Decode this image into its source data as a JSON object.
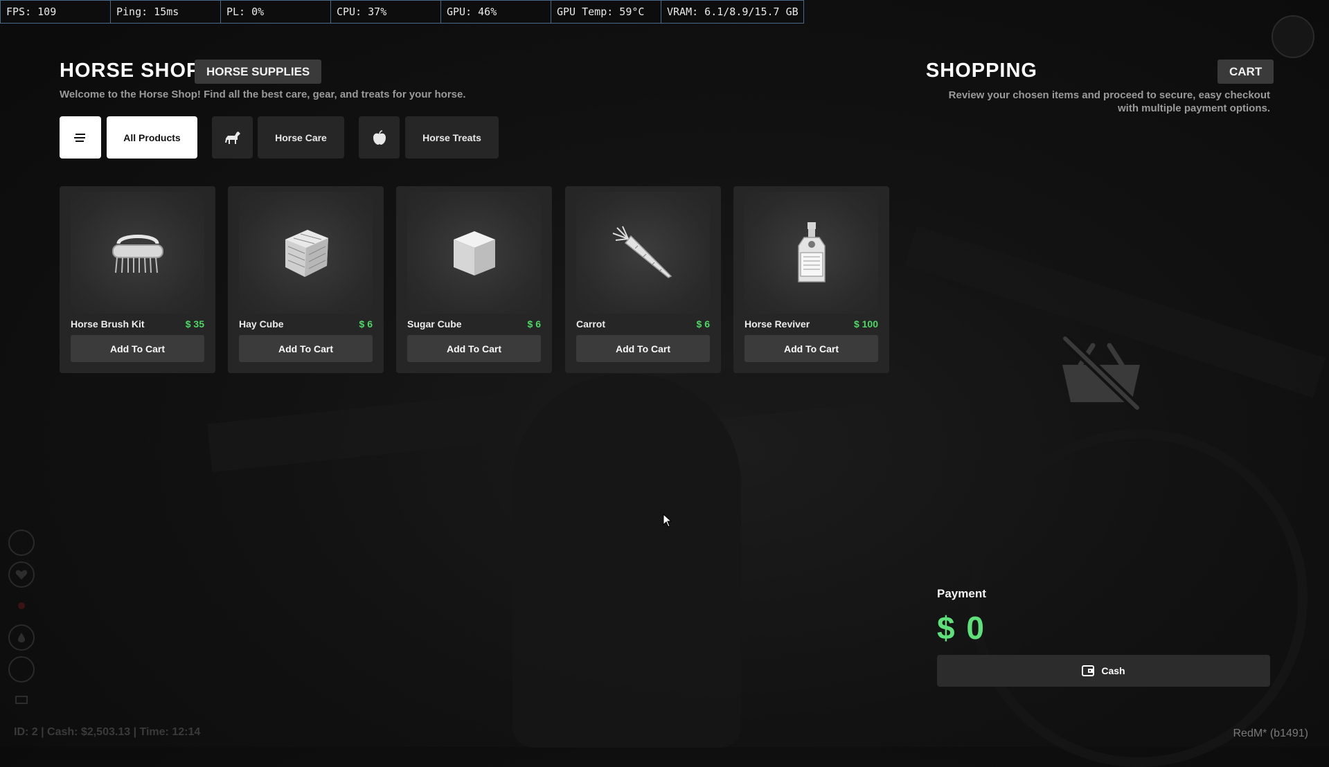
{
  "perf": [
    {
      "label": "FPS: 109"
    },
    {
      "label": "Ping: 15ms"
    },
    {
      "label": "PL: 0%"
    },
    {
      "label": "CPU: 37%"
    },
    {
      "label": "GPU: 46%"
    },
    {
      "label": "GPU Temp: 59°C"
    },
    {
      "label": "VRAM: 6.1/8.9/15.7 GB"
    }
  ],
  "shop": {
    "title": "HORSE SHOP",
    "badge": "HORSE SUPPLIES",
    "description": "Welcome to the Horse Shop! Find all the best care, gear, and treats for your horse."
  },
  "filters": {
    "all_label": "All Products",
    "care_label": "Horse Care",
    "treats_label": "Horse Treats",
    "selected": "All Products"
  },
  "products": [
    {
      "name": "Horse Brush Kit",
      "price": "$ 35",
      "button": "Add To Cart",
      "icon": "brush-icon"
    },
    {
      "name": "Hay Cube",
      "price": "$ 6",
      "button": "Add To Cart",
      "icon": "hay-icon"
    },
    {
      "name": "Sugar Cube",
      "price": "$ 6",
      "button": "Add To Cart",
      "icon": "sugar-cube-icon"
    },
    {
      "name": "Carrot",
      "price": "$ 6",
      "button": "Add To Cart",
      "icon": "carrot-icon"
    },
    {
      "name": "Horse Reviver",
      "price": "$ 100",
      "button": "Add To Cart",
      "icon": "reviver-bottle-icon"
    }
  ],
  "cart": {
    "title": "SHOPPING",
    "badge": "CART",
    "description": "Review your chosen items and proceed to secure, easy checkout with multiple payment options.",
    "empty_icon": "empty-basket-icon"
  },
  "payment": {
    "label": "Payment",
    "amount": "$ 0",
    "cash_label": "Cash"
  },
  "hud": {
    "status": "ID: 2 | Cash: $2,503.13 | Time: 12:14",
    "build": "RedM* (b1491)"
  },
  "colors": {
    "price_green": "#4cd964",
    "amount_green": "#5ee07a",
    "card_bg": "#262626"
  }
}
